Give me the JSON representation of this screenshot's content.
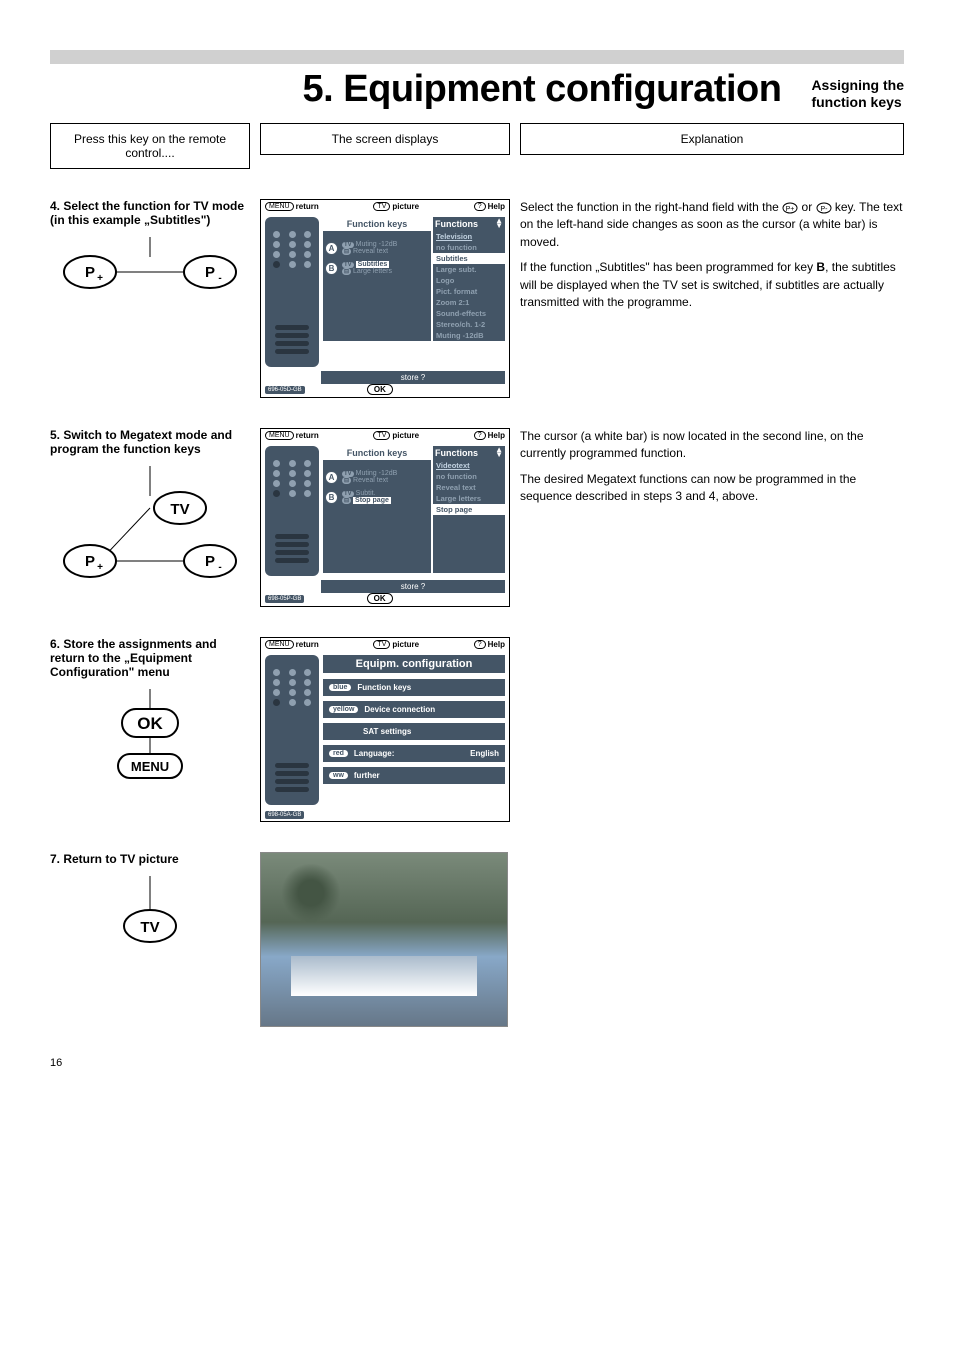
{
  "chapter": {
    "title": "5. Equipment configuration",
    "sub1": "Assigning the",
    "sub2": "function keys"
  },
  "headers": {
    "left": "Press this key on the remote control....",
    "mid": "The screen displays",
    "right": "Explanation"
  },
  "step4": {
    "title": "4. Select the function for TV mode (in this example „Subtitles\")",
    "screenTop": {
      "return": "return",
      "picture": "picture",
      "help": "Help"
    },
    "fkTitle": "Function keys",
    "fnTitle": "Functions",
    "rowA": {
      "line1": "Muting -12dB",
      "line2": "Reveal text"
    },
    "rowB": {
      "line1": "Subtitles",
      "line2": "Large letters"
    },
    "functions": [
      "Television",
      "no function",
      "Subtitles",
      "Large subt.",
      "Logo",
      "Pict. format",
      "Zoom 2:1",
      "Sound-effects",
      "Stereo/ch. 1-2",
      "Muting -12dB"
    ],
    "fnHighlight": "Subtitles",
    "store": "store ?",
    "ok": "OK",
    "code": "696-05D-GB",
    "exp1": "Select the function in the right-hand field with the ",
    "exp1b": " or ",
    "exp1c": " key. The text on the left-hand side changes as soon as the cursor (a white bar) is moved.",
    "exp2a": "If the function „Subtitles\" has been programmed for key ",
    "exp2bold": "B",
    "exp2b": ", the subtitles will be displayed when the TV set is switched, if subtitles are actually transmitted with the programme."
  },
  "step5": {
    "title": "5. Switch to Megatext mode and program the function keys",
    "rowA": {
      "line1": "Muting -12dB",
      "line2": "Reveal text"
    },
    "rowB": {
      "line1": "Subtit.",
      "line2": "Stop page"
    },
    "functions": [
      "Videotext",
      "no function",
      "Reveal text",
      "Large letters",
      "Stop page"
    ],
    "fnHighlight": "Stop page",
    "store": "store ?",
    "code": "698-05P-GB",
    "exp1": "The cursor (a white bar) is now located in the second line, on the currently programmed function.",
    "exp2": "The desired Megatext functions can now be programmed in the sequence described in steps 3 and 4, above."
  },
  "step6": {
    "title": "6. Store the assignments and return to the „Equipment Configuration\" menu",
    "equipTitle": "Equipm. configuration",
    "items": [
      {
        "btn": "blue",
        "label": "Function keys"
      },
      {
        "btn": "yellow",
        "label": "Device connection"
      },
      {
        "btn": "",
        "label": "SAT settings"
      },
      {
        "btn": "red",
        "label": "Language:",
        "extra": "English"
      },
      {
        "btn": "ww",
        "label": "further"
      }
    ],
    "code": "698-05A-GB",
    "okKey": "OK",
    "menuKey": "MENU"
  },
  "step7": {
    "title": "7. Return to TV picture",
    "tvKey": "TV"
  },
  "keys": {
    "pPlus": "P+",
    "pMinus": "P-",
    "tv": "TV"
  },
  "pageNum": "16"
}
